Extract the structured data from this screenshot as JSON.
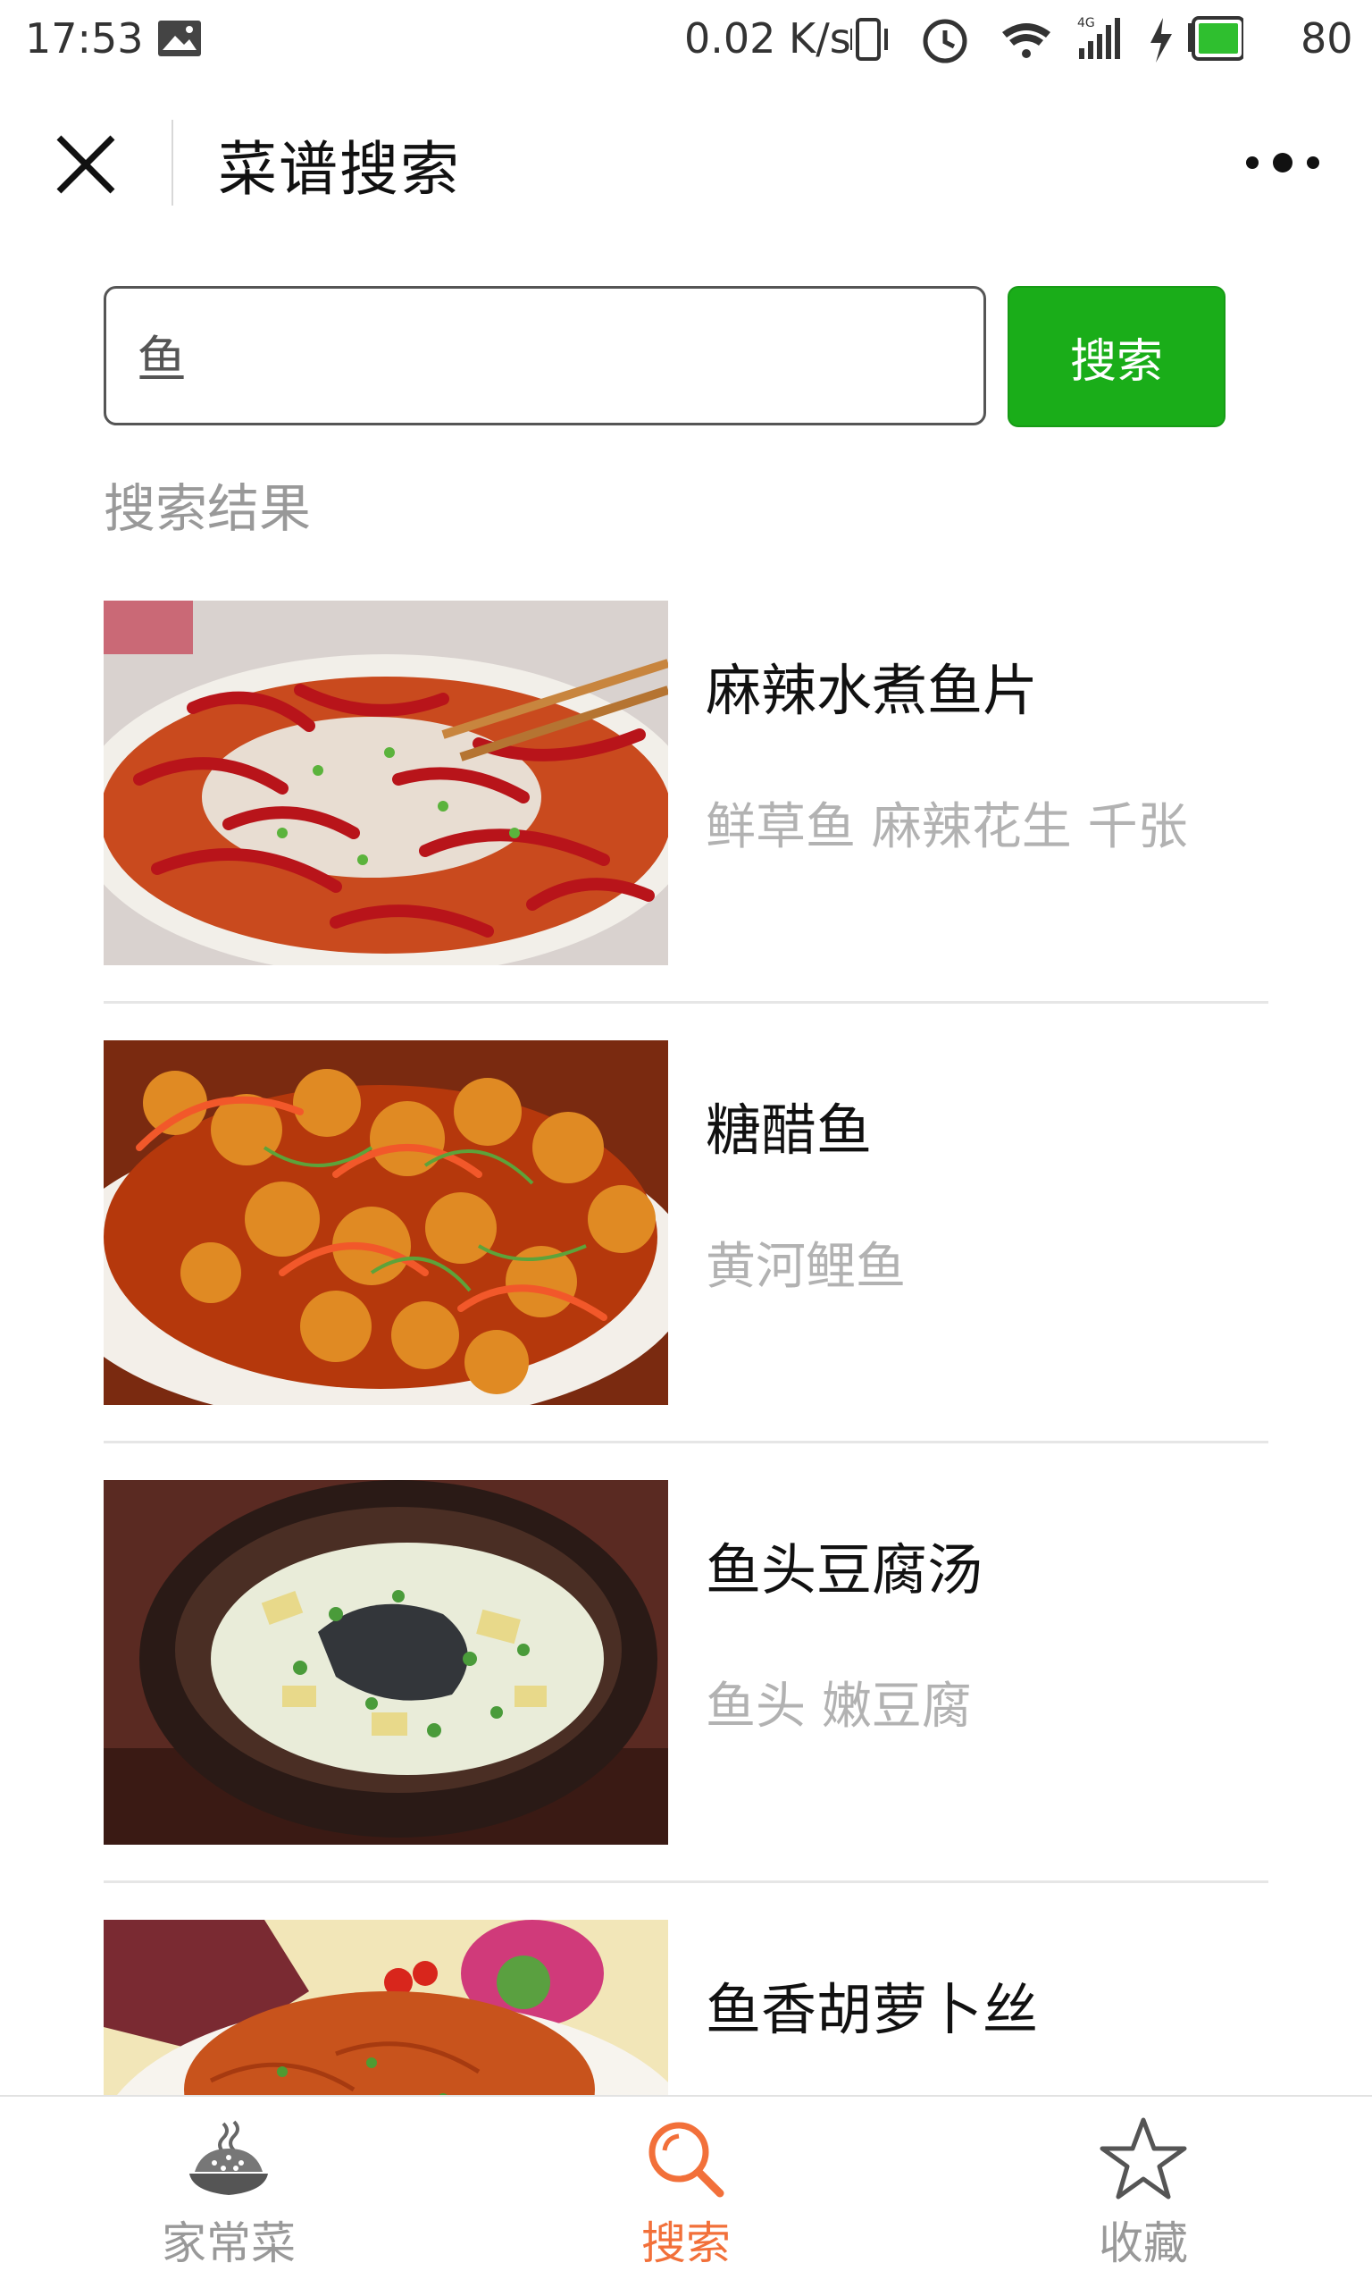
{
  "status_bar": {
    "time": "17:53",
    "speed": "0.02 K/s",
    "battery": "80"
  },
  "header": {
    "title": "菜谱搜索"
  },
  "search": {
    "value": "鱼",
    "button_label": "搜索"
  },
  "results": {
    "heading": "搜索结果",
    "items": [
      {
        "title": "麻辣水煮鱼片",
        "ingredients": "鲜草鱼 麻辣花生 千张"
      },
      {
        "title": "糖醋鱼",
        "ingredients": "黄河鲤鱼"
      },
      {
        "title": "鱼头豆腐汤",
        "ingredients": "鱼头 嫩豆腐"
      },
      {
        "title": "鱼香胡萝卜丝",
        "ingredients": ""
      }
    ]
  },
  "tab_bar": {
    "tabs": [
      {
        "label": "家常菜",
        "icon": "rice-bowl-icon"
      },
      {
        "label": "搜索",
        "icon": "search-icon",
        "active": true
      },
      {
        "label": "收藏",
        "icon": "star-icon"
      }
    ]
  },
  "colors": {
    "accent_green": "#1aad19",
    "active_tab": "#f2703a",
    "muted_text": "#b2b2b2"
  }
}
